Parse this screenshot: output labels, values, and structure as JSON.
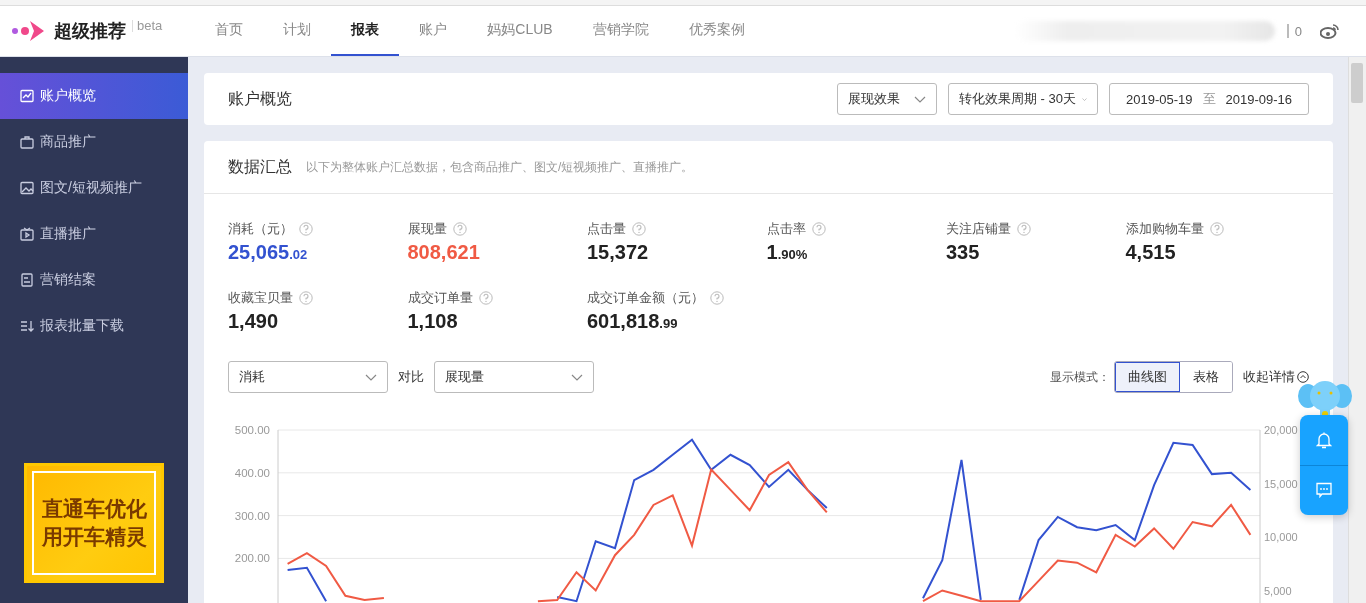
{
  "header": {
    "logo": "超级推荐",
    "badge": "beta",
    "nav": [
      {
        "label": "首页",
        "selected": false
      },
      {
        "label": "计划",
        "selected": false
      },
      {
        "label": "报表",
        "selected": true
      },
      {
        "label": "账户",
        "selected": false
      },
      {
        "label": "妈妈CLUB",
        "selected": false
      },
      {
        "label": "营销学院",
        "selected": false
      },
      {
        "label": "优秀案例",
        "selected": false
      }
    ],
    "message_count": "0"
  },
  "sidebar": {
    "items": [
      {
        "label": "账户概览",
        "kind": "chart",
        "selected": true
      },
      {
        "label": "商品推广",
        "kind": "bag",
        "selected": false
      },
      {
        "label": "图文/短视频推广",
        "kind": "image",
        "selected": false
      },
      {
        "label": "直播推广",
        "kind": "tv",
        "selected": false
      },
      {
        "label": "营销结案",
        "kind": "doc",
        "selected": false
      },
      {
        "label": "报表批量下载",
        "kind": "download",
        "selected": false
      }
    ],
    "banner": {
      "lines": [
        "直通车优化",
        "用开车精灵"
      ]
    }
  },
  "overview": {
    "title": "账户概览",
    "filters": [
      "展现效果",
      "转化效果周期 - 30天"
    ],
    "date_from": "2019-05-19",
    "date_sep": "至",
    "date_to": "2019-09-16"
  },
  "summary": {
    "title": "数据汇总",
    "note": "以下为整体账户汇总数据，包含商品推广、图文/短视频推广、直播推广。",
    "metrics": [
      {
        "label": "消耗（元）",
        "value": "25,065",
        "decimals": ".02",
        "color": "#3352d0"
      },
      {
        "label": "展现量",
        "value": "808,621",
        "color": "#f05a44"
      },
      {
        "label": "点击量",
        "value": "15,372",
        "color": "#222222"
      },
      {
        "label": "点击率",
        "value": "1",
        "decimals": ".90%",
        "color": "#222222"
      },
      {
        "label": "关注店铺量",
        "value": "335",
        "color": "#222222"
      },
      {
        "label": "添加购物车量",
        "value": "4,515",
        "color": "#222222"
      },
      {
        "label": "收藏宝贝量",
        "value": "1,490",
        "color": "#222222"
      },
      {
        "label": "成交订单量",
        "value": "1,108",
        "color": "#222222"
      },
      {
        "label": "成交订单金额（元）",
        "value": "601,818",
        "decimals": ".99",
        "color": "#222222"
      }
    ],
    "compare_label": "对比",
    "mode_label": "显示模式：",
    "modes": [
      {
        "label": "曲线图",
        "selected": true
      },
      {
        "label": "表格",
        "selected": false
      }
    ],
    "collapse": "收起详情",
    "chart_data": {
      "type": "line",
      "grid": true,
      "categories": [
        null,
        null,
        null,
        null,
        null,
        null,
        null,
        null,
        null,
        null,
        null,
        null,
        null,
        null,
        null,
        null,
        null,
        null,
        null,
        null,
        null,
        null,
        null,
        null,
        null,
        null,
        null,
        null,
        null,
        null,
        null,
        null,
        null,
        null,
        null,
        null,
        null,
        null,
        null,
        null,
        null,
        null,
        null,
        null,
        null,
        null,
        null,
        null,
        null,
        null,
        null
      ],
      "ylim": [
        0,
        500
      ],
      "yticks": [
        {
          "value": 200,
          "label": "200.00"
        },
        {
          "value": 300,
          "label": "300.00"
        },
        {
          "value": 400,
          "label": "400.00"
        },
        {
          "value": 500,
          "label": "500.00"
        }
      ],
      "y2lim": [
        0,
        20000
      ],
      "y2ticks": [
        {
          "value": 5000,
          "label": "5,000"
        },
        {
          "value": 10000,
          "label": "10,000"
        },
        {
          "value": 15000,
          "label": "15,000"
        },
        {
          "value": 20000,
          "label": "20,000"
        }
      ],
      "series": [
        {
          "name": "消耗",
          "color": "#3352d0",
          "values": [
            173,
            178,
            100,
            null,
            null,
            null,
            null,
            null,
            null,
            null,
            null,
            null,
            null,
            null,
            110,
            100,
            240,
            224,
            383,
            407,
            442,
            477,
            407,
            442,
            418,
            367,
            407,
            360,
            318,
            null,
            null,
            null,
            null,
            107,
            196,
            430,
            103,
            null,
            103,
            243,
            297,
            273,
            266,
            278,
            243,
            371,
            470,
            465,
            397,
            400,
            360
          ]
        },
        {
          "name": "展现量",
          "color": "#f05a44",
          "axis": "y2",
          "values": [
            7500,
            8500,
            7300,
            4500,
            4100,
            4300,
            null,
            null,
            null,
            null,
            null,
            null,
            null,
            4000,
            4100,
            6700,
            5000,
            8300,
            10200,
            13000,
            13900,
            9200,
            16300,
            14400,
            12500,
            15800,
            17000,
            14400,
            12300,
            null,
            null,
            null,
            null,
            4000,
            5000,
            4500,
            4000,
            4000,
            4000,
            5900,
            7800,
            7600,
            6700,
            10200,
            9100,
            10800,
            8900,
            11400,
            11000,
            13000,
            10200
          ]
        }
      ]
    }
  }
}
